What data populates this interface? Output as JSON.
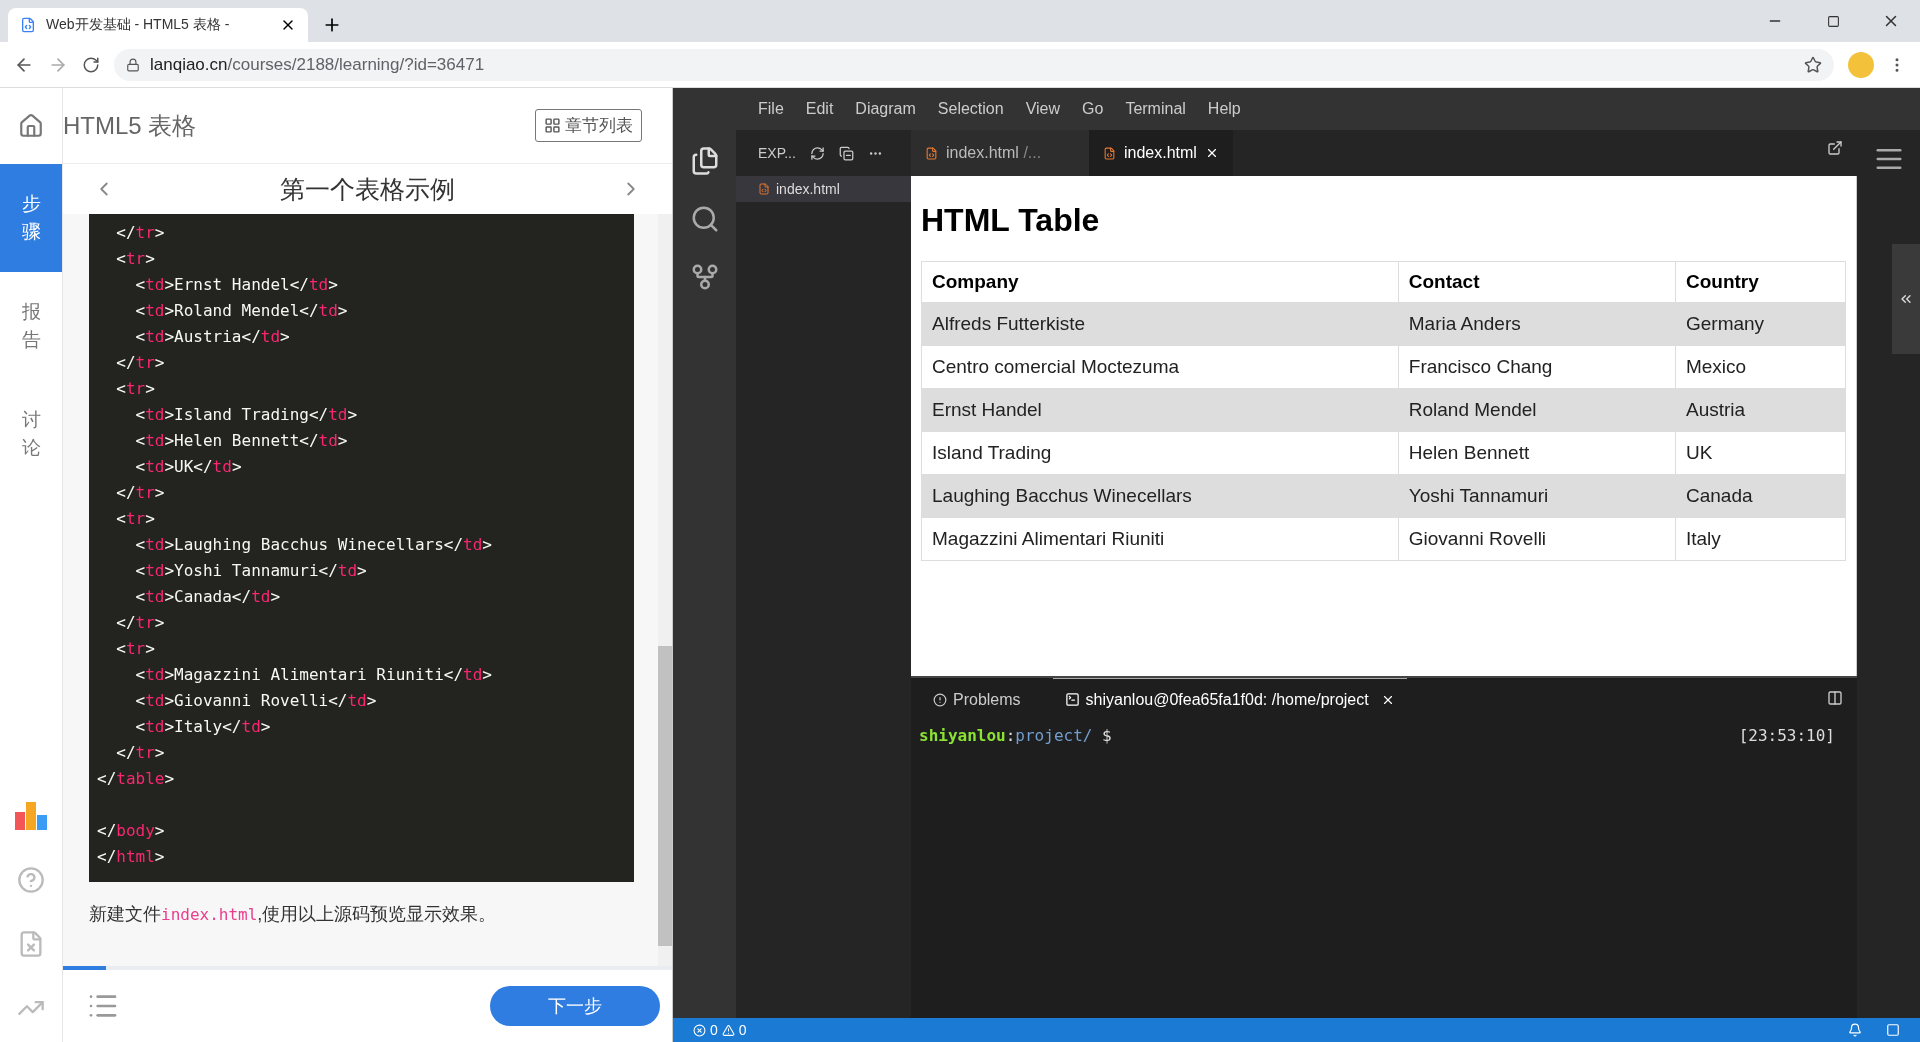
{
  "browser": {
    "tab_title": "Web开发基础 - HTML5 表格 - ",
    "url_host": "lanqiao.cn",
    "url_path": "/courses/2188/learning/?id=36471"
  },
  "course": {
    "title": "HTML5 表格",
    "chapters_button": "章节列表",
    "step_title": "第一个表格示例",
    "next_button": "下一步",
    "progress": {
      "level": 0.07
    }
  },
  "rail": [
    {
      "label": "步骤",
      "selected": true
    },
    {
      "label": "报告",
      "selected": false
    },
    {
      "label": "讨论",
      "selected": false
    }
  ],
  "code_lines": [
    {
      "tokens": [
        {
          "kind": "punct",
          "text": "  </"
        },
        {
          "kind": "tag",
          "text": "tr"
        },
        {
          "kind": "punct",
          "text": ">"
        }
      ]
    },
    {
      "tokens": [
        {
          "kind": "punct",
          "text": "  <"
        },
        {
          "kind": "tag",
          "text": "tr"
        },
        {
          "kind": "punct",
          "text": ">"
        }
      ]
    },
    {
      "tokens": [
        {
          "kind": "punct",
          "text": "    <"
        },
        {
          "kind": "tag",
          "text": "td"
        },
        {
          "kind": "punct",
          "text": ">Ernst Handel</"
        },
        {
          "kind": "tag",
          "text": "td"
        },
        {
          "kind": "punct",
          "text": ">"
        }
      ]
    },
    {
      "tokens": [
        {
          "kind": "punct",
          "text": "    <"
        },
        {
          "kind": "tag",
          "text": "td"
        },
        {
          "kind": "punct",
          "text": ">Roland Mendel</"
        },
        {
          "kind": "tag",
          "text": "td"
        },
        {
          "kind": "punct",
          "text": ">"
        }
      ]
    },
    {
      "tokens": [
        {
          "kind": "punct",
          "text": "    <"
        },
        {
          "kind": "tag",
          "text": "td"
        },
        {
          "kind": "punct",
          "text": ">Austria</"
        },
        {
          "kind": "tag",
          "text": "td"
        },
        {
          "kind": "punct",
          "text": ">"
        }
      ]
    },
    {
      "tokens": [
        {
          "kind": "punct",
          "text": "  </"
        },
        {
          "kind": "tag",
          "text": "tr"
        },
        {
          "kind": "punct",
          "text": ">"
        }
      ]
    },
    {
      "tokens": [
        {
          "kind": "punct",
          "text": "  <"
        },
        {
          "kind": "tag",
          "text": "tr"
        },
        {
          "kind": "punct",
          "text": ">"
        }
      ]
    },
    {
      "tokens": [
        {
          "kind": "punct",
          "text": "    <"
        },
        {
          "kind": "tag",
          "text": "td"
        },
        {
          "kind": "punct",
          "text": ">Island Trading</"
        },
        {
          "kind": "tag",
          "text": "td"
        },
        {
          "kind": "punct",
          "text": ">"
        }
      ]
    },
    {
      "tokens": [
        {
          "kind": "punct",
          "text": "    <"
        },
        {
          "kind": "tag",
          "text": "td"
        },
        {
          "kind": "punct",
          "text": ">Helen Bennett</"
        },
        {
          "kind": "tag",
          "text": "td"
        },
        {
          "kind": "punct",
          "text": ">"
        }
      ]
    },
    {
      "tokens": [
        {
          "kind": "punct",
          "text": "    <"
        },
        {
          "kind": "tag",
          "text": "td"
        },
        {
          "kind": "punct",
          "text": ">UK</"
        },
        {
          "kind": "tag",
          "text": "td"
        },
        {
          "kind": "punct",
          "text": ">"
        }
      ]
    },
    {
      "tokens": [
        {
          "kind": "punct",
          "text": "  </"
        },
        {
          "kind": "tag",
          "text": "tr"
        },
        {
          "kind": "punct",
          "text": ">"
        }
      ]
    },
    {
      "tokens": [
        {
          "kind": "punct",
          "text": "  <"
        },
        {
          "kind": "tag",
          "text": "tr"
        },
        {
          "kind": "punct",
          "text": ">"
        }
      ]
    },
    {
      "tokens": [
        {
          "kind": "punct",
          "text": "    <"
        },
        {
          "kind": "tag",
          "text": "td"
        },
        {
          "kind": "punct",
          "text": ">Laughing Bacchus Winecellars</"
        },
        {
          "kind": "tag",
          "text": "td"
        },
        {
          "kind": "punct",
          "text": ">"
        }
      ]
    },
    {
      "tokens": [
        {
          "kind": "punct",
          "text": "    <"
        },
        {
          "kind": "tag",
          "text": "td"
        },
        {
          "kind": "punct",
          "text": ">Yoshi Tannamuri</"
        },
        {
          "kind": "tag",
          "text": "td"
        },
        {
          "kind": "punct",
          "text": ">"
        }
      ]
    },
    {
      "tokens": [
        {
          "kind": "punct",
          "text": "    <"
        },
        {
          "kind": "tag",
          "text": "td"
        },
        {
          "kind": "punct",
          "text": ">Canada</"
        },
        {
          "kind": "tag",
          "text": "td"
        },
        {
          "kind": "punct",
          "text": ">"
        }
      ]
    },
    {
      "tokens": [
        {
          "kind": "punct",
          "text": "  </"
        },
        {
          "kind": "tag",
          "text": "tr"
        },
        {
          "kind": "punct",
          "text": ">"
        }
      ]
    },
    {
      "tokens": [
        {
          "kind": "punct",
          "text": "  <"
        },
        {
          "kind": "tag",
          "text": "tr"
        },
        {
          "kind": "punct",
          "text": ">"
        }
      ]
    },
    {
      "tokens": [
        {
          "kind": "punct",
          "text": "    <"
        },
        {
          "kind": "tag",
          "text": "td"
        },
        {
          "kind": "punct",
          "text": ">Magazzini Alimentari Riuniti</"
        },
        {
          "kind": "tag",
          "text": "td"
        },
        {
          "kind": "punct",
          "text": ">"
        }
      ]
    },
    {
      "tokens": [
        {
          "kind": "punct",
          "text": "    <"
        },
        {
          "kind": "tag",
          "text": "td"
        },
        {
          "kind": "punct",
          "text": ">Giovanni Rovelli</"
        },
        {
          "kind": "tag",
          "text": "td"
        },
        {
          "kind": "punct",
          "text": ">"
        }
      ]
    },
    {
      "tokens": [
        {
          "kind": "punct",
          "text": "    <"
        },
        {
          "kind": "tag",
          "text": "td"
        },
        {
          "kind": "punct",
          "text": ">Italy</"
        },
        {
          "kind": "tag",
          "text": "td"
        },
        {
          "kind": "punct",
          "text": ">"
        }
      ]
    },
    {
      "tokens": [
        {
          "kind": "punct",
          "text": "  </"
        },
        {
          "kind": "tag",
          "text": "tr"
        },
        {
          "kind": "punct",
          "text": ">"
        }
      ]
    },
    {
      "tokens": [
        {
          "kind": "punct",
          "text": "</"
        },
        {
          "kind": "tag",
          "text": "table"
        },
        {
          "kind": "punct",
          "text": ">"
        }
      ]
    },
    {
      "kind": "blank"
    },
    {
      "tokens": [
        {
          "kind": "punct",
          "text": "</"
        },
        {
          "kind": "tag",
          "text": "body"
        },
        {
          "kind": "punct",
          "text": ">"
        }
      ]
    },
    {
      "tokens": [
        {
          "kind": "punct",
          "text": "</"
        },
        {
          "kind": "tag",
          "text": "html"
        },
        {
          "kind": "punct",
          "text": ">"
        }
      ]
    }
  ],
  "description": [
    {
      "kind": "text",
      "text": "新建文件"
    },
    {
      "kind": "code",
      "text": "index.html"
    },
    {
      "kind": "text",
      "text": ",使用以上源码预览显示效果。"
    }
  ],
  "ide": {
    "menu": [
      "File",
      "Edit",
      "Diagram",
      "Selection",
      "View",
      "Go",
      "Terminal",
      "Help"
    ],
    "explorer_title": "EXP...",
    "files": [
      {
        "name": "index.html",
        "selected": true
      }
    ],
    "editor_tabs": [
      {
        "name": "index.html",
        "path": "/...",
        "selected": false
      },
      {
        "name": "index.html",
        "selected": true
      }
    ],
    "preview": {
      "heading": "HTML Table",
      "columns": [
        "Company",
        "Contact",
        "Country"
      ],
      "rows": [
        [
          "Alfreds Futterkiste",
          "Maria Anders",
          "Germany"
        ],
        [
          "Centro comercial Moctezuma",
          "Francisco Chang",
          "Mexico"
        ],
        [
          "Ernst Handel",
          "Roland Mendel",
          "Austria"
        ],
        [
          "Island Trading",
          "Helen Bennett",
          "UK"
        ],
        [
          "Laughing Bacchus Winecellars",
          "Yoshi Tannamuri",
          "Canada"
        ],
        [
          "Magazzini Alimentari Riuniti",
          "Giovanni Rovelli",
          "Italy"
        ]
      ]
    },
    "panel_tabs": [
      {
        "kind": "problems",
        "label": "Problems",
        "selected": false
      },
      {
        "kind": "terminal",
        "label": "shiyanlou@0fea65fa1f0d: /home/project",
        "selected": true
      }
    ],
    "terminal": {
      "user": "shiyanlou",
      "sep": ":",
      "dir": "project/",
      "prompt": "$",
      "time": "[23:53:10]"
    },
    "status": {
      "errors": "0",
      "warnings": "0"
    }
  }
}
